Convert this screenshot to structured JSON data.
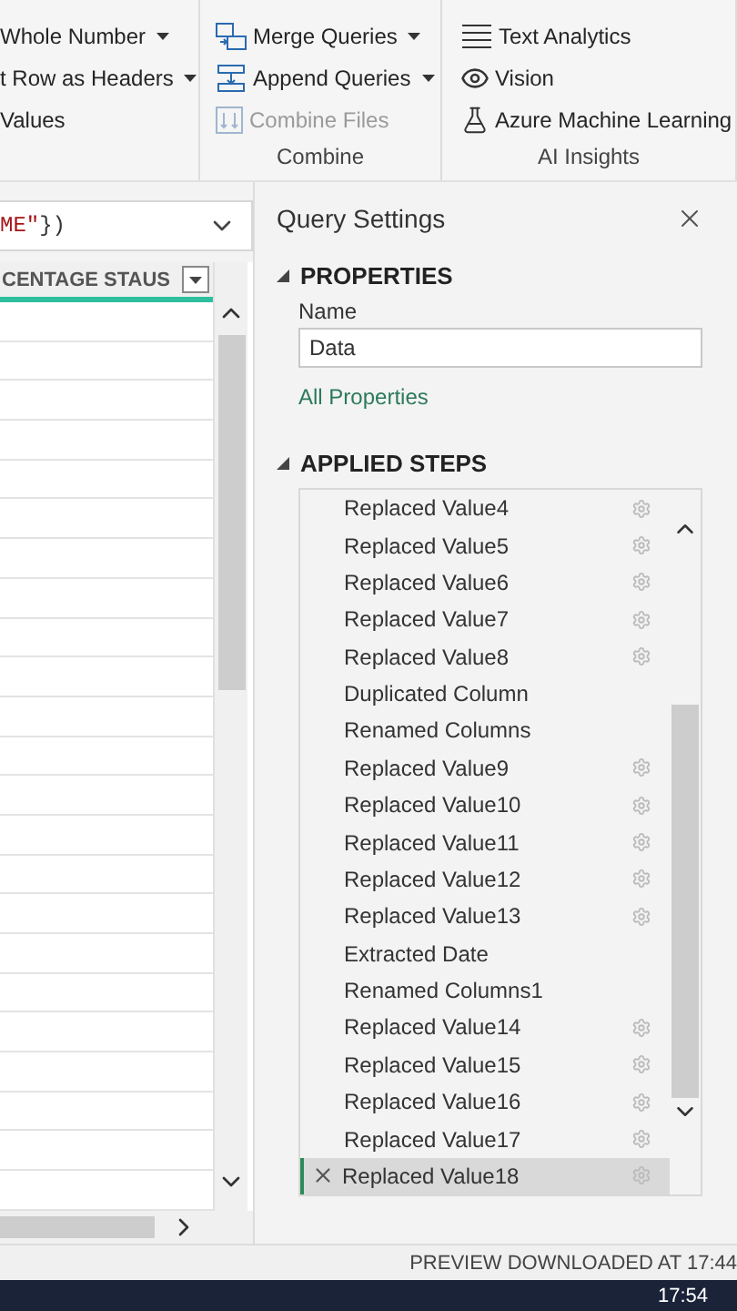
{
  "ribbon": {
    "groups": [
      {
        "items": [
          {
            "text": "Whole Number",
            "kind": "dropdown"
          },
          {
            "text": "t Row as Headers",
            "kind": "dropdown"
          },
          {
            "text": "Values",
            "kind": "plain"
          }
        ]
      },
      {
        "label": "Combine",
        "items": [
          {
            "text": "Merge Queries",
            "kind": "dropdown",
            "disabled": false
          },
          {
            "text": "Append Queries",
            "kind": "dropdown",
            "disabled": false
          },
          {
            "text": "Combine Files",
            "kind": "plain",
            "disabled": true
          }
        ]
      },
      {
        "label": "AI Insights",
        "items": [
          {
            "text": "Text Analytics",
            "kind": "plain"
          },
          {
            "text": "Vision",
            "kind": "plain"
          },
          {
            "text": "Azure Machine Learning",
            "kind": "plain"
          }
        ]
      }
    ]
  },
  "formula_bar": {
    "parts": [
      {
        "text": "ME\"",
        "kind": "string"
      },
      {
        "text": "})",
        "kind": "plain"
      }
    ]
  },
  "grid": {
    "column_header": "CENTAGE STAUS"
  },
  "query_settings": {
    "title": "Query Settings",
    "properties": {
      "heading": "PROPERTIES",
      "name_label": "Name",
      "name_value": "Data",
      "link": "All Properties"
    },
    "applied_steps": {
      "heading": "APPLIED STEPS",
      "steps": [
        {
          "label": "Replaced Value4",
          "has_settings": true,
          "selected": false
        },
        {
          "label": "Replaced Value5",
          "has_settings": true,
          "selected": false
        },
        {
          "label": "Replaced Value6",
          "has_settings": true,
          "selected": false
        },
        {
          "label": "Replaced Value7",
          "has_settings": true,
          "selected": false
        },
        {
          "label": "Replaced Value8",
          "has_settings": true,
          "selected": false
        },
        {
          "label": "Duplicated Column",
          "has_settings": false,
          "selected": false
        },
        {
          "label": "Renamed Columns",
          "has_settings": false,
          "selected": false
        },
        {
          "label": "Replaced Value9",
          "has_settings": true,
          "selected": false
        },
        {
          "label": "Replaced Value10",
          "has_settings": true,
          "selected": false
        },
        {
          "label": "Replaced Value11",
          "has_settings": true,
          "selected": false
        },
        {
          "label": "Replaced Value12",
          "has_settings": true,
          "selected": false
        },
        {
          "label": "Replaced Value13",
          "has_settings": true,
          "selected": false
        },
        {
          "label": "Extracted Date",
          "has_settings": false,
          "selected": false
        },
        {
          "label": "Renamed Columns1",
          "has_settings": false,
          "selected": false
        },
        {
          "label": "Replaced Value14",
          "has_settings": true,
          "selected": false
        },
        {
          "label": "Replaced Value15",
          "has_settings": true,
          "selected": false
        },
        {
          "label": "Replaced Value16",
          "has_settings": true,
          "selected": false
        },
        {
          "label": "Replaced Value17",
          "has_settings": true,
          "selected": false
        },
        {
          "label": "Replaced Value18",
          "has_settings": true,
          "selected": true
        }
      ]
    }
  },
  "status_bar": {
    "text": "PREVIEW DOWNLOADED AT 17:44"
  },
  "taskbar": {
    "time": "17:54"
  }
}
